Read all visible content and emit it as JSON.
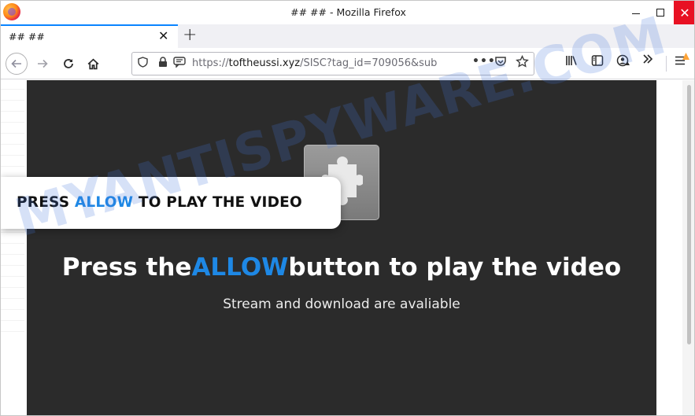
{
  "window": {
    "title": "## ## - Mozilla Firefox",
    "close_glyph": "✕"
  },
  "tabs": [
    {
      "title": "## ##",
      "close_glyph": "✕"
    }
  ],
  "new_tab_glyph": "+",
  "urlbar": {
    "url_host": "toftheussi.xyz",
    "url_prefix": "https://",
    "url_rest": "/SISC?tag_id=709056&sub",
    "page_actions_glyph": "•••"
  },
  "icons": {
    "back": "arrow-left-icon",
    "forward": "arrow-right-icon",
    "reload": "reload-icon",
    "home": "home-icon",
    "shield": "shield-icon",
    "lock": "lock-icon",
    "permission": "notification-permission-icon",
    "pocket": "pocket-icon",
    "bookmark": "star-icon",
    "library": "library-icon",
    "sidebar": "sidebar-icon",
    "sync": "account-icon",
    "overflow": "chevron-double-right-icon",
    "menu": "hamburger-menu-icon",
    "update_warning": "warning-icon",
    "plugin": "puzzle-piece-icon"
  },
  "page": {
    "callout": {
      "part1": "PRESS ",
      "highlight": "ALLOW",
      "part2": " TO PLAY THE VIDEO"
    },
    "headline": {
      "part1": "Press the",
      "highlight": "ALLOW",
      "part2": "button to play the video"
    },
    "subline": "Stream and download are avaliable",
    "watermark": "MYANTISPYWARE.COM"
  },
  "colors": {
    "highlight_blue": "#1e88e5",
    "panel_dark": "#2b2b2b",
    "close_red": "#e81123",
    "tab_accent": "#0a84ff"
  }
}
